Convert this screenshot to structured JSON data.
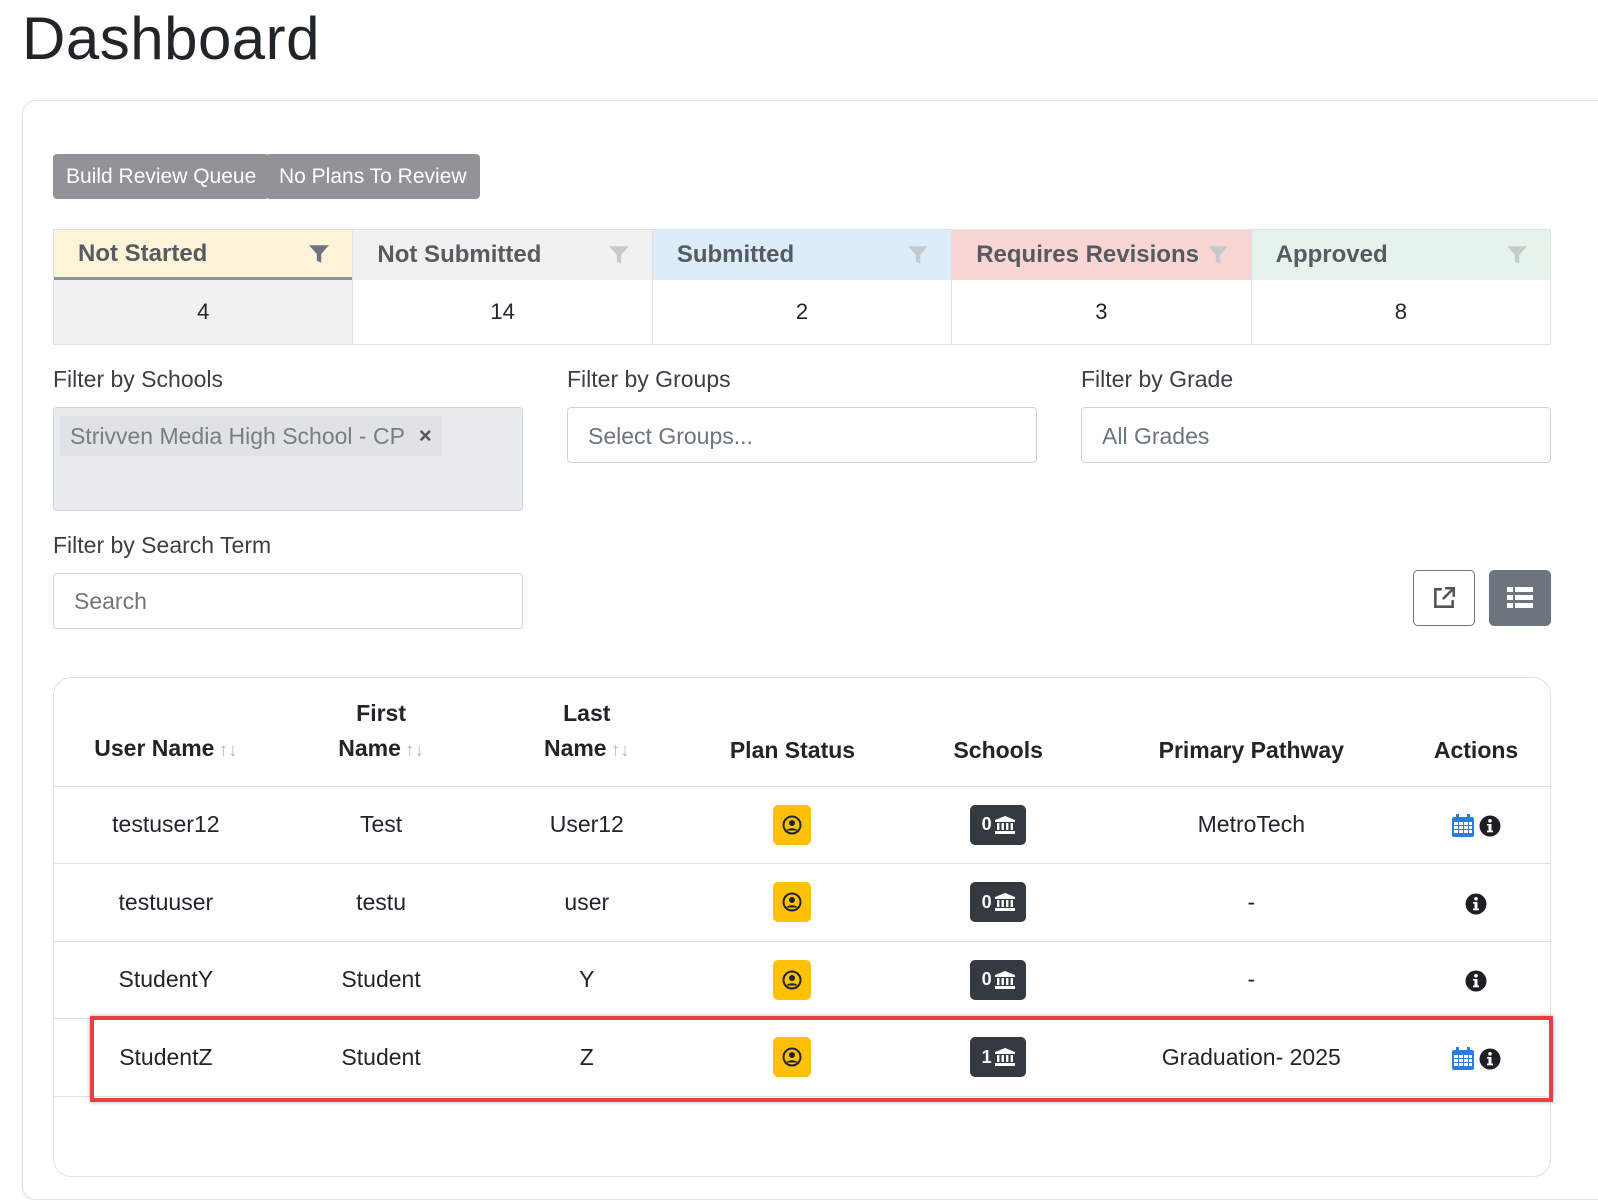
{
  "page": {
    "title": "Dashboard"
  },
  "toolbar": {
    "build_queue_label": "Build Review Queue",
    "no_plans_label": "No Plans To Review"
  },
  "status_tabs": [
    {
      "label": "Not Started",
      "count": "4",
      "color": "#fdf3d8"
    },
    {
      "label": "Not Submitted",
      "count": "14",
      "color": "#f1f1f1"
    },
    {
      "label": "Submitted",
      "count": "2",
      "color": "#dcecf9"
    },
    {
      "label": "Requires Revisions",
      "count": "3",
      "color": "#f9d5d3"
    },
    {
      "label": "Approved",
      "count": "8",
      "color": "#e6f3eb"
    }
  ],
  "filters": {
    "schools_label": "Filter by Schools",
    "schools_selected": "Strivven Media High School - CP",
    "groups_label": "Filter by Groups",
    "groups_placeholder": "Select Groups...",
    "grade_label": "Filter by Grade",
    "grade_value": "All Grades",
    "search_label": "Filter by Search Term",
    "search_placeholder": "Search"
  },
  "table": {
    "headers": {
      "user_name": "User Name",
      "first_name_1": "First",
      "first_name_2": "Name",
      "last_name_1": "Last",
      "last_name_2": "Name",
      "plan_status": "Plan Status",
      "schools": "Schools",
      "primary_pathway": "Primary Pathway",
      "actions": "Actions"
    },
    "rows": [
      {
        "user_name": "testuser12",
        "first_name": "Test",
        "last_name": "User12",
        "schools": "0",
        "pathway": "MetroTech",
        "calendar": true
      },
      {
        "user_name": "testuuser",
        "first_name": "testu",
        "last_name": "user",
        "schools": "0",
        "pathway": "-",
        "calendar": false
      },
      {
        "user_name": "StudentY",
        "first_name": "Student",
        "last_name": "Y",
        "schools": "0",
        "pathway": "-",
        "calendar": false
      },
      {
        "user_name": "StudentZ",
        "first_name": "Student",
        "last_name": "Z",
        "schools": "1",
        "pathway": "Graduation- 2025",
        "calendar": true
      }
    ]
  },
  "icons": {
    "filter": "filter-icon",
    "remove": "close-icon",
    "export": "external-link-icon",
    "view": "list-icon",
    "plan_status": "user-circle-icon",
    "school": "university-icon",
    "calendar": "calendar-icon",
    "info": "info-circle-icon"
  }
}
